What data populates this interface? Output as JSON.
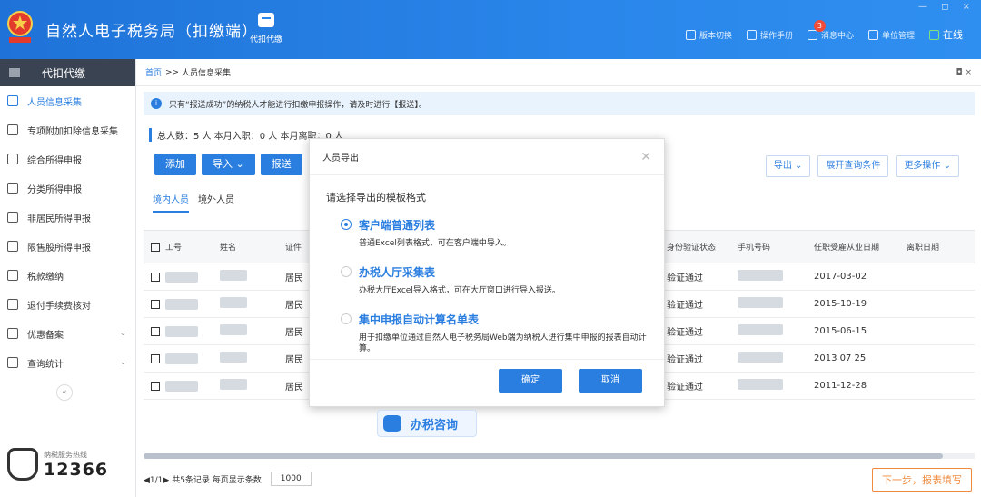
{
  "app": {
    "title": "自然人电子税务局（扣缴端）",
    "module_label": "代扣代缴",
    "tools": [
      {
        "label": "版本切换",
        "icon": "version-icon"
      },
      {
        "label": "操作手册",
        "icon": "manual-icon"
      },
      {
        "label": "消息中心",
        "icon": "message-icon",
        "badge": "3"
      },
      {
        "label": "单位管理",
        "icon": "org-icon"
      },
      {
        "label": "在线",
        "icon": "online-icon"
      }
    ],
    "window_controls": "— ◻ ×",
    "colors": {
      "primary": "#2a7ee0",
      "titlebar": "#2a86ea",
      "accent": "#f08a3c"
    }
  },
  "sidebar": {
    "header": "代扣代缴",
    "items": [
      {
        "label": "人员信息采集",
        "active": true
      },
      {
        "label": "专项附加扣除信息采集"
      },
      {
        "label": "综合所得申报"
      },
      {
        "label": "分类所得申报"
      },
      {
        "label": "非居民所得申报"
      },
      {
        "label": "限售股所得申报"
      },
      {
        "label": "税款缴纳"
      },
      {
        "label": "退付手续费核对"
      },
      {
        "label": "优惠备案",
        "chevron": "⌄"
      },
      {
        "label": "查询统计",
        "chevron": "⌄"
      }
    ],
    "collapse": "«",
    "hotline_label": "纳税服务热线",
    "hotline_number": "12366"
  },
  "main": {
    "breadcrumb_home": "首页",
    "breadcrumb_sep": ">>",
    "breadcrumb_current": "人员信息采集",
    "notice": "只有“报送成功”的纳税人才能进行扣缴申报操作，请及时进行【报送】。",
    "stats": "总人数：5 人   本月入职：0 人   本月离职：0 人",
    "buttons": {
      "add": "添加",
      "import": "导入 ⌄",
      "submit": "报送"
    },
    "right_buttons": {
      "export": "导出 ⌄",
      "expand": "展开查询条件",
      "more": "更多操作 ⌄"
    },
    "tabs": [
      "境内人员",
      "境外人员"
    ],
    "table_headers": {
      "id": "工号",
      "name": "姓名",
      "cert": "证件",
      "verify": "身份验证状态",
      "phone": "手机号码",
      "hire": "任职受雇从业日期",
      "leave": "离职日期"
    },
    "rows": [
      {
        "cert": "居民",
        "verify": "验证通过",
        "hire": "2017-03-02"
      },
      {
        "cert": "居民",
        "verify": "验证通过",
        "hire": "2015-10-19"
      },
      {
        "cert": "居民",
        "verify": "验证通过",
        "hire": "2015-06-15"
      },
      {
        "cert": "居民",
        "verify": "验证通过",
        "hire": "2013 07 25"
      },
      {
        "cert": "居民",
        "verify": "验证通过",
        "hire": "2011-12-28"
      }
    ],
    "footer_pager": "◀1/1▶ 共5条记录  每页显示条数",
    "page_size": "1000",
    "next_button": "下一步，报表填写",
    "consult": "办税咨询"
  },
  "modal": {
    "title": "人员导出",
    "prompt": "请选择导出的模板格式",
    "options": [
      {
        "label": "客户端普通列表",
        "desc": "普通Excel列表格式，可在客户端中导入。",
        "selected": true
      },
      {
        "label": "办税人厅采集表",
        "desc": "办税大厅Excel导入格式，可在大厅窗口进行导入报送。",
        "selected": false
      },
      {
        "label": "集中申报自动计算名单表",
        "desc": "用于扣缴单位通过自然人电子税务局Web端为纳税人进行集中申报的报表自动计算。",
        "selected": false
      }
    ],
    "ok": "确定",
    "cancel": "取消"
  }
}
